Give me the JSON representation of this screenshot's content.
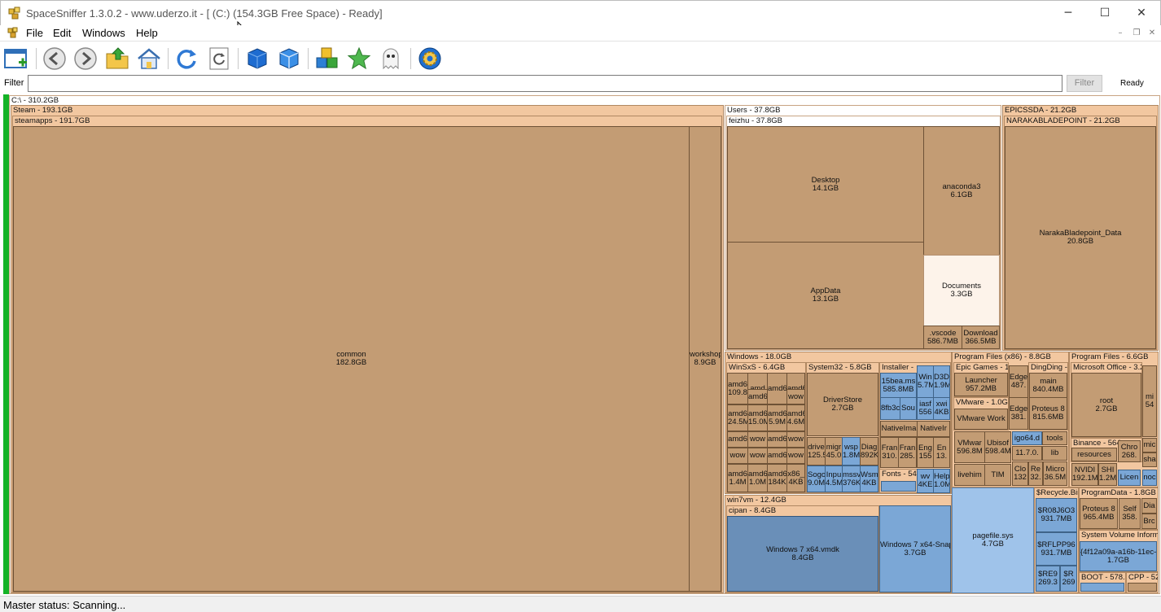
{
  "window": {
    "title": "SpaceSniffer 1.3.0.2 - www.uderzo.it - [ (C:) (154.3GB Free Space) - Ready]",
    "minimize": "─",
    "maximize": "☐",
    "close": "✕"
  },
  "menu": {
    "file": "File",
    "edit": "Edit",
    "windows": "Windows",
    "help": "Help"
  },
  "mdi": {
    "minimize": "–",
    "restore": "❐",
    "close": "✕"
  },
  "toolbar": {
    "buttons": [
      "new-view",
      "back",
      "forward",
      "open-folder",
      "home",
      "refresh",
      "refresh-all",
      "blue-cube",
      "blue-cube-2",
      "cubes",
      "star",
      "ghost",
      "settings"
    ]
  },
  "filter": {
    "label": "Filter",
    "value": "",
    "button": "Filter",
    "status": "Ready"
  },
  "status": {
    "text": "Master status: Scanning..."
  },
  "treemap": {
    "drive": "C:\\ - 310.2GB",
    "steam": "Steam - 193.1GB",
    "steamapps": "steamapps - 191.7GB",
    "common_name": "common",
    "common_size": "182.8GB",
    "workshop_name": "workshop",
    "workshop_size": "8.9GB",
    "users": "Users - 37.8GB",
    "feizhu": "feizhu - 37.8GB",
    "desktop_name": "Desktop",
    "desktop_size": "14.1GB",
    "anaconda_name": "anaconda3",
    "anaconda_size": "6.1GB",
    "appdata_name": "AppData",
    "appdata_size": "13.1GB",
    "documents_name": "Documents",
    "documents_size": "3.3GB",
    "vscode_name": ".vscode",
    "vscode_size": "586.7MB",
    "downloads_name": "Download",
    "downloads_size": "366.5MB",
    "epicssda": "EPICSSDA - 21.2GB",
    "naraka": "NARAKABLADEPOINT - 21.2GB",
    "narakadata_name": "NarakaBladepoint_Data",
    "narakadata_size": "20.8GB",
    "windows": "Windows - 18.0GB",
    "winsxs": "WinSxS - 6.4GB",
    "system32": "System32 - 5.8GB",
    "installer": "Installer -",
    "driverstore_name": "DriverStore",
    "driverstore_size": "2.7GB",
    "sxs": [
      "amd6\n109.8",
      "amd",
      "amd6",
      "amd6",
      "amd",
      "amd6",
      "wow",
      "amd6\n24.5M",
      "amd6\n15.0M",
      "amd6\n5.9M",
      "amd6\n4.6M",
      "amd6",
      "wow",
      "amd6",
      "wow",
      "wow",
      "wow",
      "amd6",
      "wow",
      "amd6\n1.4M",
      "amd6\n1.0M",
      "amd6\n184K",
      "x86_\n4KB"
    ],
    "s32": [
      "drive\n125.5",
      "migr\n45.0",
      "wsp\n1.8M",
      "Diag\n892K",
      "Sogo\n9.0M",
      "Inpu\n4.5M",
      "mssv\n376K",
      "Wsm\n4KB"
    ],
    "inst": [
      "15bea.ms\n585.8MB",
      "Win\n5.7M",
      "D3D\n1.9M",
      "8fb3c",
      "Sou",
      "iasf\n556",
      "xwi\n4KB"
    ],
    "native1": "NativeIma",
    "native2": "NativeIr",
    "fonts": "Fonts - 54",
    "fx": [
      "Fran\n310.",
      "Fran\n285.",
      "Eng\n155",
      "En\n13."
    ],
    "wv": "wv\n4KE",
    "help": "Help\n1.0M",
    "pfx86": "Program Files (x86) - 8.8GB",
    "epicgames": "Epic Games - 1",
    "launcher_name": "Launcher",
    "launcher_size": "957.2MB",
    "edge1": "Edge\n487.",
    "edge2": "Edge\n381.",
    "dingding": "DingDing -",
    "main_name": "main",
    "main_size": "840.4MB",
    "proteus_name": "Proteus 8",
    "proteus_size": "815.6MB",
    "vmware": "VMware - 1.0G",
    "vmwork": "VMware Work",
    "vmwar_name": "VMwar",
    "vmwar_size": "596.8M",
    "ubisoft_name": "Ubisof",
    "ubisoft_size": "598.4M",
    "igo": "igo64.d",
    "tools": "tools",
    "v1170": "11.7.0.",
    "lib": "lib",
    "clo": "Clo\n132",
    "re": "Re\n32.",
    "micro": "Micro\n36.5M",
    "livehime": "livehim",
    "tim": "TIM",
    "pf": "Program Files - 6.6GB",
    "msoffice": "Microsoft Office - 3.2",
    "root_name": "root",
    "root_size": "2.7GB",
    "mi": "mi\n54",
    "binance": "Binance - 564",
    "resources": "resources",
    "chro": "Chro\n268.",
    "nvidi": "NVIDI\n192.1M",
    "shi": "SHI\n1.2M",
    "licen": "Licen",
    "noc": "noc",
    "mic2": "mic",
    "sha": "sha",
    "win7vm": "win7vm - 12.4GB",
    "cipan": "cipan - 8.4GB",
    "vmdk_name": "Windows 7 x64.vmdk",
    "vmdk_size": "8.4GB",
    "snap_name": "Windows 7 x64-Snap",
    "snap_size": "3.7GB",
    "pagefile_name": "pagefile.sys",
    "pagefile_size": "4.7GB",
    "recycle": "$Recycle.Bin",
    "r1": "$R08J6O3\n931.7MB",
    "r2": "$RFLPP96\n931.7MB",
    "r3": "$RE9\n269.3",
    "r4": "$R\n269",
    "programdata": "ProgramData - 1.8GB",
    "pd_proteus": "Proteus 8\n965.4MB",
    "self": "Self\n358.",
    "dia": "Dia",
    "brc": "Brc",
    "svi": "System Volume Inform",
    "svi_guid": "{4f12a09a-a16b-11ec-",
    "svi_size": "1.7GB",
    "boot": "BOOT - 578.",
    "cpp": "CPP - 52"
  }
}
